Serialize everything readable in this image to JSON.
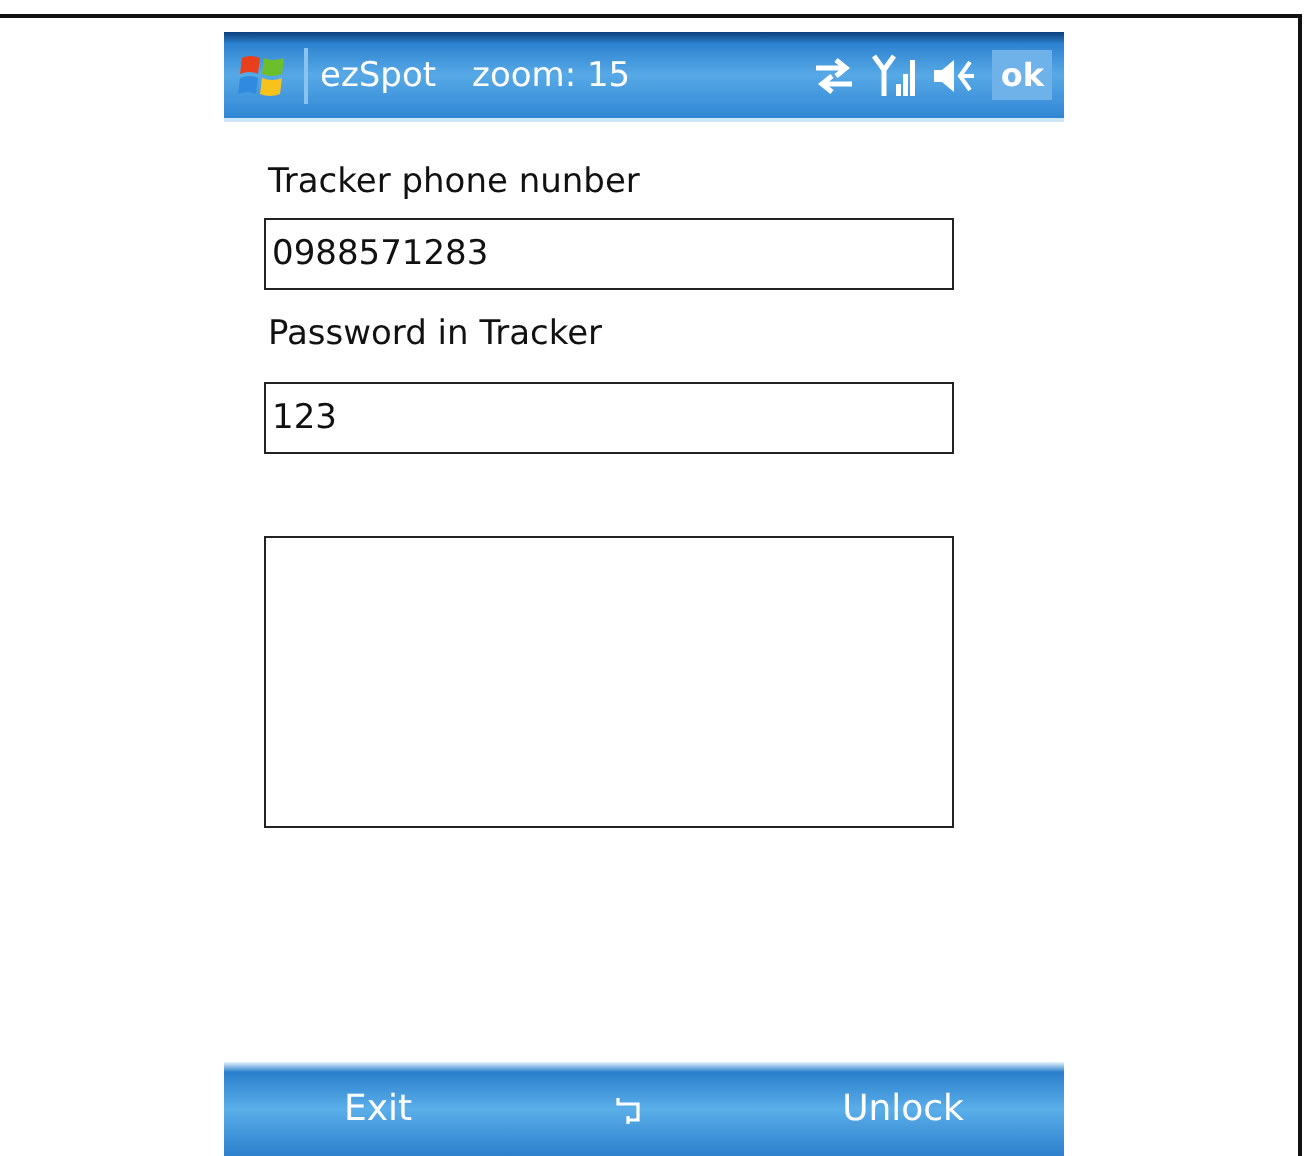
{
  "title_bar": {
    "app_name": "ezSpot",
    "status": "zoom: 15",
    "ok_button": "ok"
  },
  "form": {
    "fields": [
      {
        "label": "Tracker phone nunber",
        "value": "0988571283"
      },
      {
        "label": "Password in Tracker",
        "value": "123"
      }
    ]
  },
  "soft_keys": {
    "left": "Exit",
    "right": "Unlock"
  }
}
